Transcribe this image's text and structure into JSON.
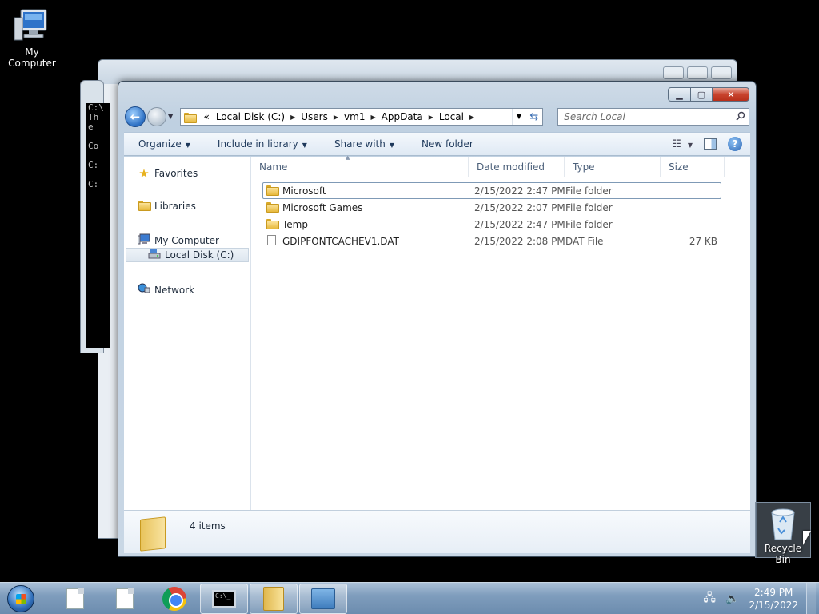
{
  "desktop": {
    "icons": [
      {
        "label": "My Computer"
      },
      {
        "label": "Recycle Bin"
      }
    ]
  },
  "cmd_bg": {
    "lines": [
      "C:\\",
      "Th",
      "e",
      "",
      "Co",
      "",
      "C:",
      "",
      "C:"
    ]
  },
  "explorer": {
    "address": {
      "overflow": "«",
      "crumbs": [
        "Local Disk (C:)",
        "Users",
        "vm1",
        "AppData",
        "Local"
      ]
    },
    "search_placeholder": "Search Local",
    "commands": {
      "organize": "Organize",
      "include": "Include in library",
      "share": "Share with",
      "new_folder": "New folder"
    },
    "nav": {
      "favorites": "Favorites",
      "libraries": "Libraries",
      "my_computer": "My Computer",
      "local_disk": "Local Disk (C:)",
      "network": "Network"
    },
    "columns": {
      "name": "Name",
      "date": "Date modified",
      "type": "Type",
      "size": "Size"
    },
    "files": [
      {
        "name": "Microsoft",
        "date": "2/15/2022 2:47 PM",
        "type": "File folder",
        "size": "",
        "kind": "folder"
      },
      {
        "name": "Microsoft Games",
        "date": "2/15/2022 2:07 PM",
        "type": "File folder",
        "size": "",
        "kind": "folder"
      },
      {
        "name": "Temp",
        "date": "2/15/2022 2:47 PM",
        "type": "File folder",
        "size": "",
        "kind": "folder"
      },
      {
        "name": "GDIPFONTCACHEV1.DAT",
        "date": "2/15/2022 2:08 PM",
        "type": "DAT File",
        "size": "27 KB",
        "kind": "file"
      }
    ],
    "item_count": "4 items"
  },
  "taskbar": {
    "time": "2:49 PM",
    "date": "2/15/2022"
  },
  "colors": {
    "desktop_bg": "#000000",
    "accent": "#2c6fc3",
    "close_red": "#c8432d"
  }
}
